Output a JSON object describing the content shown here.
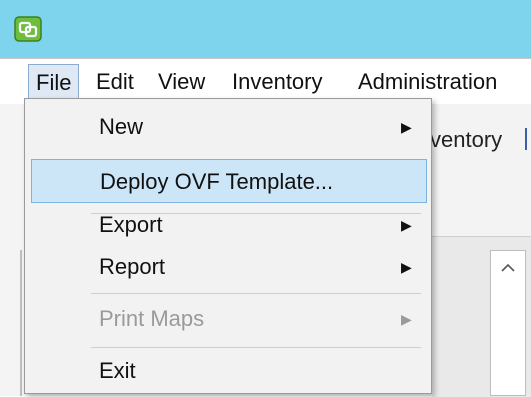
{
  "menubar": {
    "items": [
      {
        "label": "File"
      },
      {
        "label": "Edit"
      },
      {
        "label": "View"
      },
      {
        "label": "Inventory"
      },
      {
        "label": "Administration"
      }
    ]
  },
  "toolbar": {
    "partial_label": "ventory"
  },
  "file_menu": {
    "items": [
      {
        "label": "New",
        "submenu": true,
        "state": "normal"
      },
      {
        "label": "Deploy OVF Template...",
        "submenu": false,
        "state": "highlighted"
      },
      {
        "label": "Export",
        "submenu": true,
        "state": "normal"
      },
      {
        "label": "Report",
        "submenu": true,
        "state": "normal"
      },
      {
        "label": "Print Maps",
        "submenu": true,
        "state": "disabled"
      },
      {
        "label": "Exit",
        "submenu": false,
        "state": "normal"
      }
    ]
  },
  "icons": {
    "app": "app-icon",
    "submenu_arrow": "triangle-right-icon",
    "scroll_up": "chevron-up-icon"
  },
  "colors": {
    "titlebar": "#7ed4ec",
    "highlight": "#cde6f7",
    "highlight_border": "#7db3dd"
  }
}
